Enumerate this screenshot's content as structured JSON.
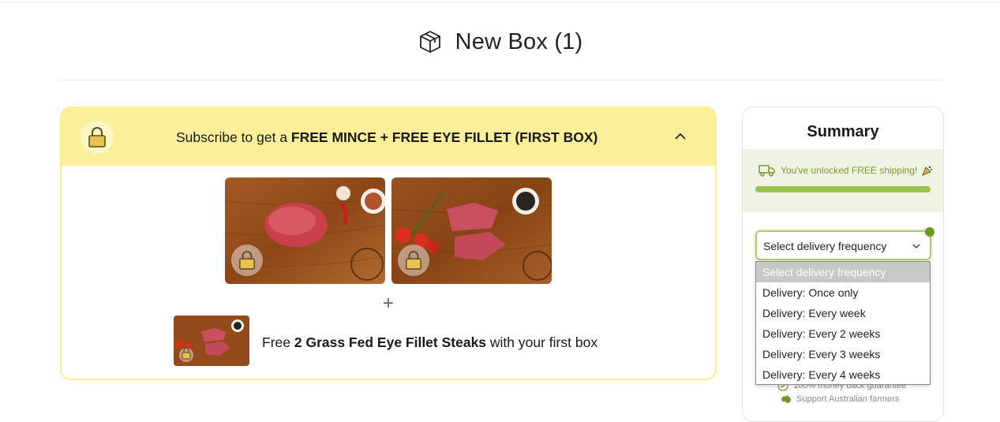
{
  "header": {
    "title": "New Box (1)",
    "icon": "box-icon"
  },
  "promo": {
    "prefix": "Subscribe to get a ",
    "highlight": "FREE MINCE + FREE EYE FILLET (FIRST BOX)",
    "free_prefix": "Free ",
    "free_bold": "2 Grass Fed Eye Fillet Steaks",
    "free_suffix": " with your first box",
    "plus": "+",
    "lock_color": "#e8c24a"
  },
  "summary": {
    "title": "Summary",
    "shipping_message": "You've unlocked FREE shipping!",
    "shipping_progress": 1.0,
    "select_value": "Select delivery frequency",
    "guarantee": "100% money back guarantee",
    "farmers": "Support Australian farmers",
    "accent": "#9cc44c"
  },
  "dropdown": {
    "options": [
      "Select delivery frequency",
      "Delivery: Once only",
      "Delivery: Every week",
      "Delivery: Every 2 weeks",
      "Delivery: Every 3 weeks",
      "Delivery: Every 4 weeks"
    ],
    "selected_index": 0
  }
}
